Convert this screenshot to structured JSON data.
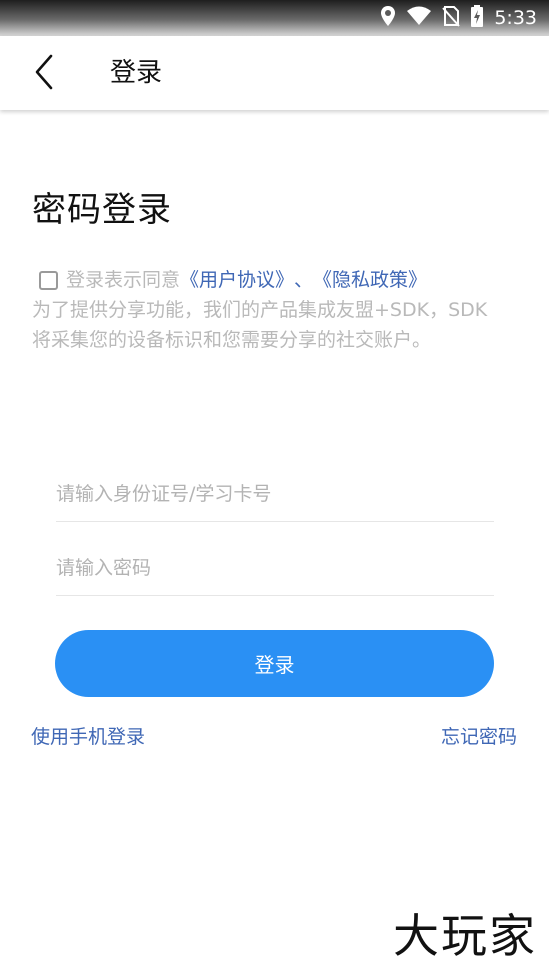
{
  "status_bar": {
    "time": "5:33",
    "icons": [
      "location-icon",
      "wifi-icon",
      "no-sim-icon",
      "battery-charging-icon"
    ]
  },
  "app_bar": {
    "back_icon": "chevron-left-icon",
    "title": "登录"
  },
  "page_title": "密码登录",
  "agreement": {
    "prefix": "登录表示同意",
    "user_agreement": "《用户协议》",
    "separator": "、",
    "privacy_policy": "《隐私政策》",
    "notice": "为了提供分享功能，我们的产品集成友盟+SDK，SDK将采集您的设备标识和您需要分享的社交账户。"
  },
  "form": {
    "id_placeholder": "请输入身份证号/学习卡号",
    "password_placeholder": "请输入密码",
    "login_label": "登录"
  },
  "links": {
    "phone_login": "使用手机登录",
    "forgot_password": "忘记密码"
  },
  "watermark": "大玩家",
  "colors": {
    "primary": "#2a90f4",
    "link": "#3f67b5",
    "hint": "#b9b9b9"
  }
}
